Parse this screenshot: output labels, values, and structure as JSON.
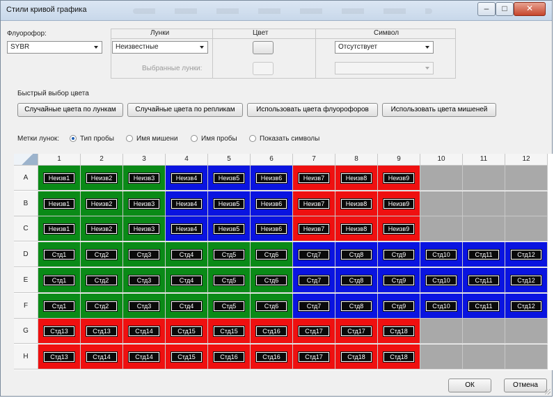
{
  "window": {
    "title": "Стили кривой графика",
    "buttons": {
      "minimize": "–",
      "maximize": "□",
      "close": "✕"
    }
  },
  "fluorophore": {
    "label": "Флуорофор:",
    "value": "SYBR"
  },
  "header": {
    "wells": "Лунки",
    "color": "Цвет",
    "symbol": "Символ"
  },
  "wells_select": {
    "value": "Неизвестные"
  },
  "symbol_select": {
    "value": "Отсутствует",
    "selected_wells_value": ""
  },
  "selected_wells_label": "Выбранные лунки:",
  "quick_color": {
    "label": "Быстрый выбор цвета",
    "buttons": [
      "Случайные цвета по лункам",
      "Случайные цвета по репликам",
      "Использовать цвета флуорофоров",
      "Использовать цвета мишеней"
    ]
  },
  "well_labels": {
    "label": "Метки лунок:",
    "options": [
      {
        "label": "Тип пробы",
        "checked": true
      },
      {
        "label": "Имя мишени",
        "checked": false
      },
      {
        "label": "Имя пробы",
        "checked": false
      },
      {
        "label": "Показать символы",
        "checked": false
      }
    ]
  },
  "plate": {
    "columns": [
      "1",
      "2",
      "3",
      "4",
      "5",
      "6",
      "7",
      "8",
      "9",
      "10",
      "11",
      "12"
    ],
    "rows": [
      "A",
      "B",
      "C",
      "D",
      "E",
      "F",
      "G",
      "H"
    ],
    "colors": {
      "green": "#0a8a17",
      "blue": "#0a14e0",
      "red": "#ef1010",
      "empty": "#a9a9a9"
    },
    "wells": [
      [
        [
          "green",
          "Неизв1"
        ],
        [
          "green",
          "Неизв2"
        ],
        [
          "green",
          "Неизв3"
        ],
        [
          "blue",
          "Неизв4"
        ],
        [
          "blue",
          "Неизв5"
        ],
        [
          "blue",
          "Неизв6"
        ],
        [
          "red",
          "Неизв7"
        ],
        [
          "red",
          "Неизв8"
        ],
        [
          "red",
          "Неизв9"
        ],
        [
          "empty",
          ""
        ],
        [
          "empty",
          ""
        ],
        [
          "empty",
          ""
        ]
      ],
      [
        [
          "green",
          "Неизв1"
        ],
        [
          "green",
          "Неизв2"
        ],
        [
          "green",
          "Неизв3"
        ],
        [
          "blue",
          "Неизв4"
        ],
        [
          "blue",
          "Неизв5"
        ],
        [
          "blue",
          "Неизв6"
        ],
        [
          "red",
          "Неизв7"
        ],
        [
          "red",
          "Неизв8"
        ],
        [
          "red",
          "Неизв9"
        ],
        [
          "empty",
          ""
        ],
        [
          "empty",
          ""
        ],
        [
          "empty",
          ""
        ]
      ],
      [
        [
          "green",
          "Неизв1"
        ],
        [
          "green",
          "Неизв2"
        ],
        [
          "green",
          "Неизв3"
        ],
        [
          "blue",
          "Неизв4"
        ],
        [
          "blue",
          "Неизв5"
        ],
        [
          "blue",
          "Неизв6"
        ],
        [
          "red",
          "Неизв7"
        ],
        [
          "red",
          "Неизв8"
        ],
        [
          "red",
          "Неизв9"
        ],
        [
          "empty",
          ""
        ],
        [
          "empty",
          ""
        ],
        [
          "empty",
          ""
        ]
      ],
      [
        [
          "green",
          "Стд1"
        ],
        [
          "green",
          "Стд2"
        ],
        [
          "green",
          "Стд3"
        ],
        [
          "green",
          "Стд4"
        ],
        [
          "green",
          "Стд5"
        ],
        [
          "green",
          "Стд6"
        ],
        [
          "blue",
          "Стд7"
        ],
        [
          "blue",
          "Стд8"
        ],
        [
          "blue",
          "Стд9"
        ],
        [
          "blue",
          "Стд10"
        ],
        [
          "blue",
          "Стд11"
        ],
        [
          "blue",
          "Стд12"
        ]
      ],
      [
        [
          "green",
          "Стд1"
        ],
        [
          "green",
          "Стд2"
        ],
        [
          "green",
          "Стд3"
        ],
        [
          "green",
          "Стд4"
        ],
        [
          "green",
          "Стд5"
        ],
        [
          "green",
          "Стд6"
        ],
        [
          "blue",
          "Стд7"
        ],
        [
          "blue",
          "Стд8"
        ],
        [
          "blue",
          "Стд9"
        ],
        [
          "blue",
          "Стд10"
        ],
        [
          "blue",
          "Стд11"
        ],
        [
          "blue",
          "Стд12"
        ]
      ],
      [
        [
          "green",
          "Стд1"
        ],
        [
          "green",
          "Стд2"
        ],
        [
          "green",
          "Стд3"
        ],
        [
          "green",
          "Стд4"
        ],
        [
          "green",
          "Стд5"
        ],
        [
          "green",
          "Стд6"
        ],
        [
          "blue",
          "Стд7"
        ],
        [
          "blue",
          "Стд8"
        ],
        [
          "blue",
          "Стд9"
        ],
        [
          "blue",
          "Стд10"
        ],
        [
          "blue",
          "Стд11"
        ],
        [
          "blue",
          "Стд12"
        ]
      ],
      [
        [
          "red",
          "Стд13"
        ],
        [
          "red",
          "Стд13"
        ],
        [
          "red",
          "Стд14"
        ],
        [
          "red",
          "Стд15"
        ],
        [
          "red",
          "Стд15"
        ],
        [
          "red",
          "Стд16"
        ],
        [
          "red",
          "Стд17"
        ],
        [
          "red",
          "Стд17"
        ],
        [
          "red",
          "Стд18"
        ],
        [
          "empty",
          ""
        ],
        [
          "empty",
          ""
        ],
        [
          "empty",
          ""
        ]
      ],
      [
        [
          "red",
          "Стд13"
        ],
        [
          "red",
          "Стд14"
        ],
        [
          "red",
          "Стд14"
        ],
        [
          "red",
          "Стд15"
        ],
        [
          "red",
          "Стд16"
        ],
        [
          "red",
          "Стд16"
        ],
        [
          "red",
          "Стд17"
        ],
        [
          "red",
          "Стд18"
        ],
        [
          "red",
          "Стд18"
        ],
        [
          "empty",
          ""
        ],
        [
          "empty",
          ""
        ],
        [
          "empty",
          ""
        ]
      ]
    ]
  },
  "dialog_buttons": {
    "ok": "ОК",
    "cancel": "Отмена"
  }
}
